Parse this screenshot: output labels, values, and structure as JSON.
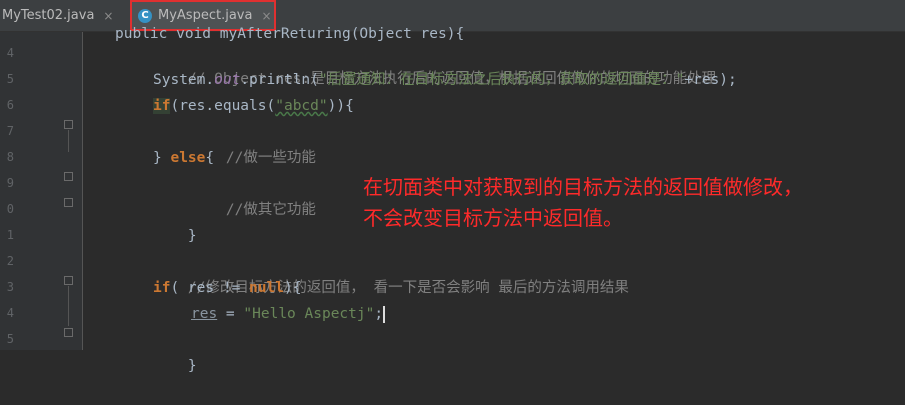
{
  "tabs": [
    {
      "label": "MyTest02.java",
      "close": "×"
    },
    {
      "label": "MyAspect.java",
      "icon_letter": "C",
      "close": "×"
    }
  ],
  "gutter": {
    "line_numbers": [
      "4",
      "5",
      "6",
      "7",
      "8",
      "9",
      "0",
      "1",
      "2",
      "3",
      "4",
      "5",
      "6"
    ]
  },
  "code": {
    "partial_top": "public void myAfterReturing(Object res){",
    "l1": "// Object res:是目标方法执行后的返回值，根据返回值做你的切面的功能处理",
    "l2_prefix": "System.",
    "l2_out": "out",
    "l2_mid": ".println(",
    "l2_str": "\"后置通知：在目标方法之后执行的，获取的返回值是：\"",
    "l2_suffix": "+res);",
    "l3_kw": "if",
    "l3_mid": "(res.equals(",
    "l3_str": "\"abcd\"",
    "l3_end": ")){",
    "l4": "//做一些功能",
    "l5_close": "} ",
    "l5_kw": "else",
    "l5_brace": "{",
    "l6": "//做其它功能",
    "l7": "}",
    "l9": "//修改目标方法的返回值， 看一下是否会影响 最后的方法调用结果",
    "l10_kw": "if",
    "l10_mid": "( res != ",
    "l10_null": "null",
    "l10_end": "){",
    "l11_var": "res",
    "l11_eq": " = ",
    "l11_str": "\"Hello Aspectj\"",
    "l11_end": ";",
    "l12": "}"
  },
  "annotation": {
    "line1": "在切面类中对获取到的目标方法的返回值做修改，",
    "line2": "不会改变目标方法中返回值。"
  },
  "colors": {
    "background": "#2b2b2b",
    "keyword": "#cc7832",
    "comment": "#808080",
    "string": "#6a8759",
    "annotation": "#ff2a2a",
    "tab_highlight_border": "#e03030"
  }
}
